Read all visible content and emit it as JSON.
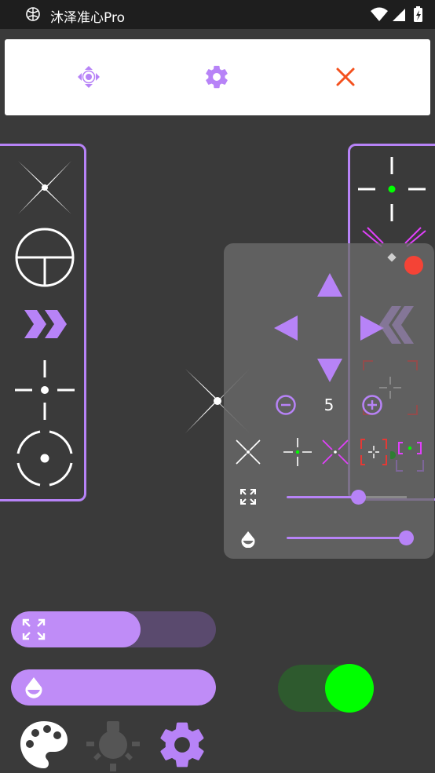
{
  "status_bar": {
    "app_title": "沐泽准心Pro",
    "icons": [
      "app-logo-icon",
      "wifi-icon",
      "cell-signal-icon",
      "battery-charging-icon"
    ]
  },
  "toolbar": {
    "buttons": [
      {
        "icon": "move-arrows-icon"
      },
      {
        "icon": "gear-icon"
      },
      {
        "icon": "close-icon"
      }
    ]
  },
  "control_panel": {
    "size_value": "5",
    "size_slider_level": 0.62,
    "opacity_slider_level": 0.95
  },
  "bottom_bars": {
    "size_bar_level": 0.63,
    "opacity_bar_level": 1.0
  },
  "toggle": {
    "on": true
  },
  "colors": {
    "accent": "#b783f7",
    "background": "#3a3a3a",
    "toggle_on": "#00ff00",
    "close_red": "#f4511e",
    "record_red": "#f44336",
    "magenta": "#e040fb"
  }
}
